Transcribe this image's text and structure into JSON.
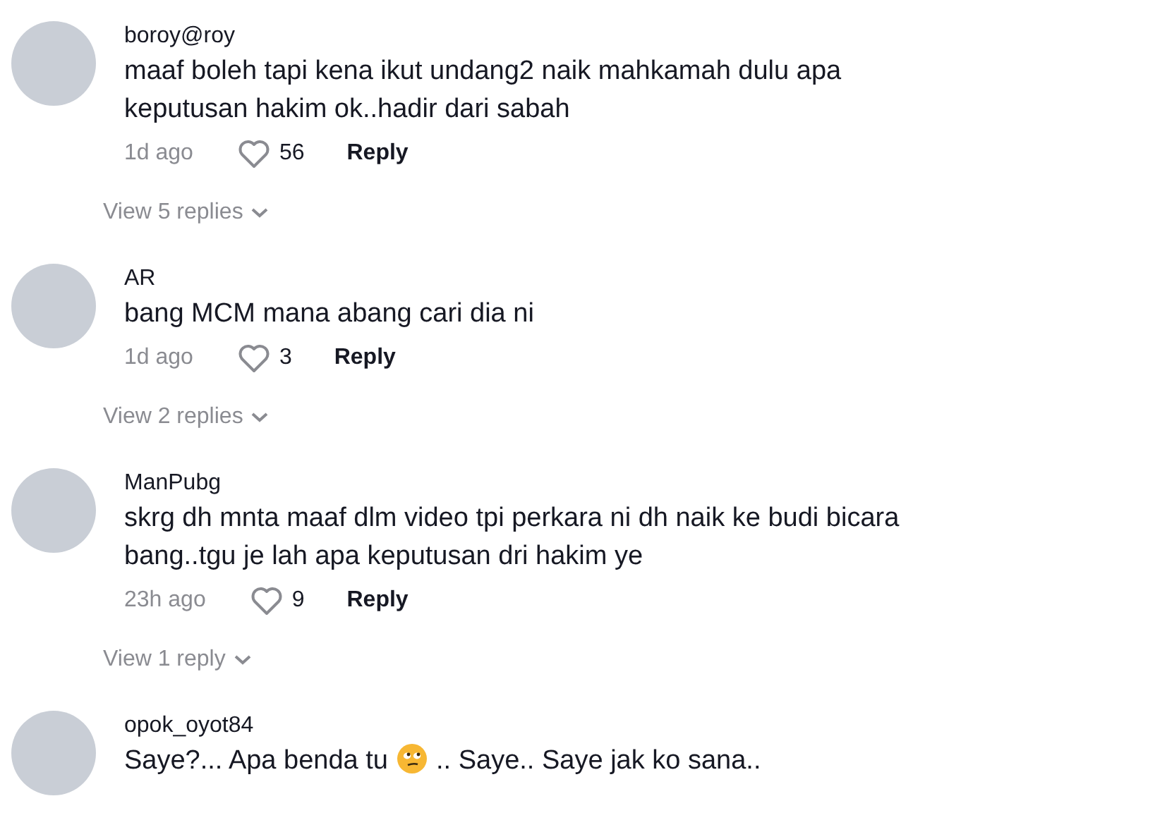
{
  "comments": [
    {
      "username": "boroy@roy",
      "body": [
        {
          "kind": "text",
          "text": "maaf boleh tapi kena ikut undang2 naik mahkamah dulu apa keputusan hakim ok..hadir dari sabah"
        }
      ],
      "time": "1d ago",
      "likes": "56",
      "reply": "Reply",
      "view_replies": "View 5 replies"
    },
    {
      "username": "AR",
      "body": [
        {
          "kind": "text",
          "text": "bang MCM mana abang cari dia ni"
        }
      ],
      "time": "1d ago",
      "likes": "3",
      "reply": "Reply",
      "view_replies": "View 2 replies"
    },
    {
      "username": "ManPubg",
      "body": [
        {
          "kind": "text",
          "text": "skrg dh mnta maaf dlm video tpi perkara ni dh naik ke budi bicara bang..tgu je lah apa keputusan dri hakim ye"
        }
      ],
      "time": "23h ago",
      "likes": "9",
      "reply": "Reply",
      "view_replies": "View 1 reply"
    },
    {
      "username": "opok_oyot84",
      "body": [
        {
          "kind": "text",
          "text": "Saye?... Apa benda tu"
        },
        {
          "kind": "emoji"
        },
        {
          "kind": "text",
          "text": ".. Saye.. Saye jak ko sana.."
        }
      ]
    }
  ]
}
